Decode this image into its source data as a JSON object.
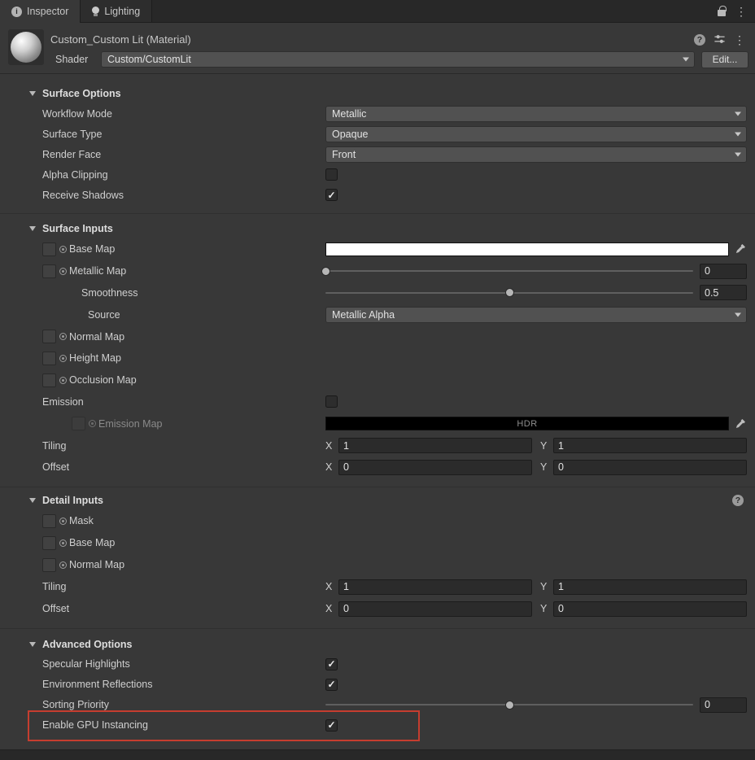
{
  "colors": {
    "annotation_red": "#c63d2f",
    "background": "#383838",
    "field_bg": "#2b2b2b",
    "dropdown_bg": "#515151"
  },
  "icons": {
    "menu": "⋮",
    "help": "?",
    "info": "i",
    "hdr_eyedropper": "eyedropper"
  },
  "tab_bar": {
    "tabs": [
      {
        "label": "Inspector"
      },
      {
        "label": "Lighting"
      }
    ]
  },
  "header": {
    "title": "Custom_Custom Lit (Material)",
    "shader_label": "Shader",
    "shader_value": "Custom/CustomLit",
    "edit_button": "Edit..."
  },
  "surface_options": {
    "title": "Surface Options",
    "workflow_mode": {
      "label": "Workflow Mode",
      "value": "Metallic"
    },
    "surface_type": {
      "label": "Surface Type",
      "value": "Opaque"
    },
    "render_face": {
      "label": "Render Face",
      "value": "Front"
    },
    "alpha_clipping": {
      "label": "Alpha Clipping",
      "checked": false
    },
    "receive_shadows": {
      "label": "Receive Shadows",
      "checked": true
    }
  },
  "surface_inputs": {
    "title": "Surface Inputs",
    "base_map": {
      "label": "Base Map",
      "swatch_color": "#ffffff"
    },
    "metallic_map": {
      "label": "Metallic Map",
      "value": "0",
      "slider_pos": 0
    },
    "smoothness": {
      "label": "Smoothness",
      "value": "0.5",
      "slider_pos": 0.5
    },
    "source": {
      "label": "Source",
      "value": "Metallic Alpha"
    },
    "normal_map": {
      "label": "Normal Map"
    },
    "height_map": {
      "label": "Height Map"
    },
    "occlusion_map": {
      "label": "Occlusion Map"
    },
    "emission": {
      "label": "Emission",
      "checked": false
    },
    "emission_map": {
      "label": "Emission Map",
      "hdr_label": "HDR",
      "swatch_color": "#000000"
    },
    "tiling": {
      "label": "Tiling",
      "x_label": "X",
      "x_value": "1",
      "y_label": "Y",
      "y_value": "1"
    },
    "offset": {
      "label": "Offset",
      "x_label": "X",
      "x_value": "0",
      "y_label": "Y",
      "y_value": "0"
    }
  },
  "detail_inputs": {
    "title": "Detail Inputs",
    "mask": {
      "label": "Mask"
    },
    "base_map": {
      "label": "Base Map"
    },
    "normal_map": {
      "label": "Normal Map"
    },
    "tiling": {
      "label": "Tiling",
      "x_label": "X",
      "x_value": "1",
      "y_label": "Y",
      "y_value": "1"
    },
    "offset": {
      "label": "Offset",
      "x_label": "X",
      "x_value": "0",
      "y_label": "Y",
      "y_value": "0"
    }
  },
  "advanced_options": {
    "title": "Advanced Options",
    "specular_highlights": {
      "label": "Specular Highlights",
      "checked": true
    },
    "environment_reflections": {
      "label": "Environment Reflections",
      "checked": true
    },
    "sorting_priority": {
      "label": "Sorting Priority",
      "value": "0",
      "slider_pos": 0.5
    },
    "enable_gpu_instancing": {
      "label": "Enable GPU Instancing",
      "checked": true
    }
  }
}
